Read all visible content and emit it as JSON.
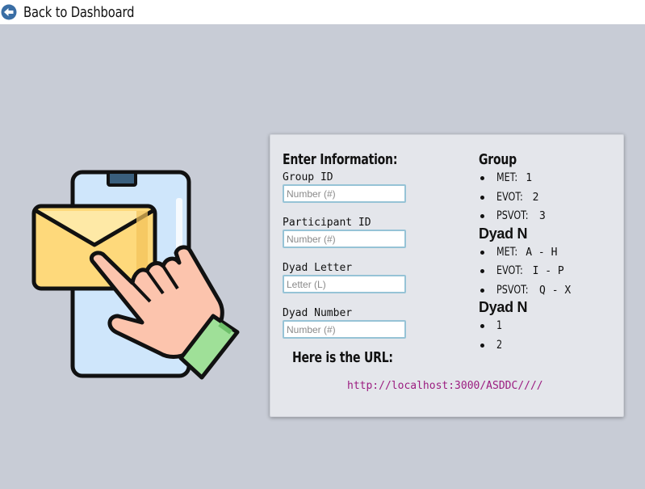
{
  "header": {
    "back_label": "Back to Dashboard",
    "back_icon": "arrow-left-circle-icon"
  },
  "illustration": {
    "icon": "phone-envelope-tap-icon",
    "colors": {
      "outline": "#111111",
      "phone": "#cfe6fb",
      "envelope": "#fed97b",
      "hand": "#fcc4ad",
      "sleeve": "#9fe098"
    }
  },
  "form": {
    "title": "Enter Information:",
    "fields": [
      {
        "label": "Group ID",
        "value": "",
        "placeholder": "Number (#)"
      },
      {
        "label": "Participant ID",
        "value": "",
        "placeholder": "Number (#)"
      },
      {
        "label": "Dyad Letter",
        "value": "",
        "placeholder": "Letter (L)"
      },
      {
        "label": "Dyad Number",
        "value": "",
        "placeholder": "Number (#)"
      }
    ],
    "url_title": "Here is the URL:",
    "url": "http://localhost:3000/ASDDC////"
  },
  "info": {
    "group": {
      "title": "Group",
      "items": [
        {
          "name": "MET:",
          "value": "1"
        },
        {
          "name": "EVOT:",
          "value": "2"
        },
        {
          "name": "PSVOT:",
          "value": "3"
        }
      ]
    },
    "dyad_letter": {
      "title": "Dyad N",
      "items": [
        {
          "name": "MET:",
          "value": "A - H"
        },
        {
          "name": "EVOT:",
          "value": "I - P"
        },
        {
          "name": "PSVOT:",
          "value": "Q - X"
        }
      ]
    },
    "dyad_number": {
      "title": "Dyad N",
      "items": [
        "1",
        "2"
      ]
    }
  },
  "colors": {
    "background": "#c8ccd6",
    "card": "#e4e6eb",
    "input_border": "#96c3d6",
    "url": "#9b1c80",
    "back_icon": "#3a6ea5"
  }
}
